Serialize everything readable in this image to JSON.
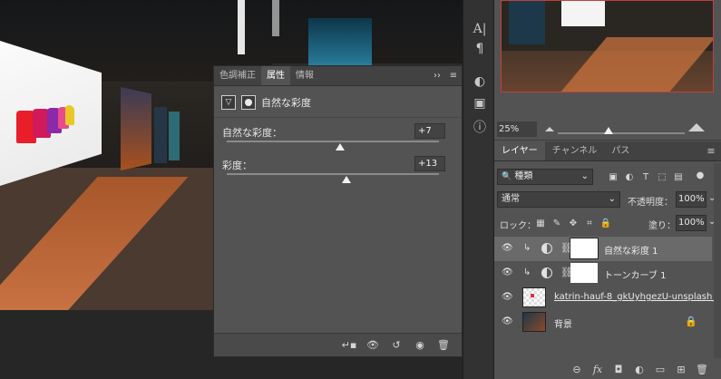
{
  "properties_panel": {
    "tabs": [
      "色調補正",
      "属性",
      "情報"
    ],
    "active_tab": "属性",
    "expand_glyph": "››",
    "menu_glyph": "≡",
    "adjustment_title": "自然な彩度",
    "vibrance": {
      "label": "自然な彩度：",
      "value": "+7",
      "level": 7,
      "min": -100,
      "max": 100
    },
    "saturation": {
      "label": "彩度：",
      "value": "+13",
      "level": 13,
      "min": -100,
      "max": 100
    },
    "footer_icons": [
      "clip-to-layer-icon",
      "view-previous-state-icon",
      "reset-icon",
      "visibility-icon",
      "trash-icon"
    ]
  },
  "toolbar_strip": {
    "icons": [
      "character-icon",
      "paragraph-icon",
      "adjustments-icon",
      "3d-icon",
      "info-icon"
    ],
    "glyphs": {
      "char": "A|",
      "para": "¶",
      "adj": "◐",
      "cube": "▣",
      "info": "ⓘ"
    }
  },
  "navigator": {
    "zoom": "25%"
  },
  "layers_panel": {
    "tabs": [
      "レイヤー",
      "チャンネル",
      "パス"
    ],
    "active_tab": "レイヤー",
    "filter_kind": "種類",
    "filter_glyph": "🔍",
    "blend_mode": "通常",
    "opacity_label": "不透明度：",
    "opacity_value": "100%",
    "lock_label": "ロック：",
    "fill_label": "塗り：",
    "fill_value": "100%",
    "layers": [
      {
        "name": "自然な彩度 1",
        "type": "adjustment",
        "selected": true
      },
      {
        "name": "トーンカーブ 1",
        "type": "adjustment",
        "selected": false
      },
      {
        "name": "katrin-hauf-8_gkUyhgezU-unsplash_...",
        "type": "smart-object",
        "selected": false
      },
      {
        "name": "背景",
        "type": "background",
        "selected": false
      }
    ],
    "footer_icons": [
      "link-icon",
      "fx-icon",
      "add-mask-icon",
      "new-adjustment-icon",
      "new-group-icon",
      "new-layer-icon",
      "delete-layer-icon"
    ],
    "footer_glyphs": [
      "⊖",
      "fx",
      "◘",
      "◐",
      "▭",
      "⊞",
      "🗑"
    ]
  },
  "colors": {
    "panel": "#535353",
    "panel_dark": "#424242",
    "selected_layer": "#6a6a6a",
    "accent_red": "#c04040"
  }
}
